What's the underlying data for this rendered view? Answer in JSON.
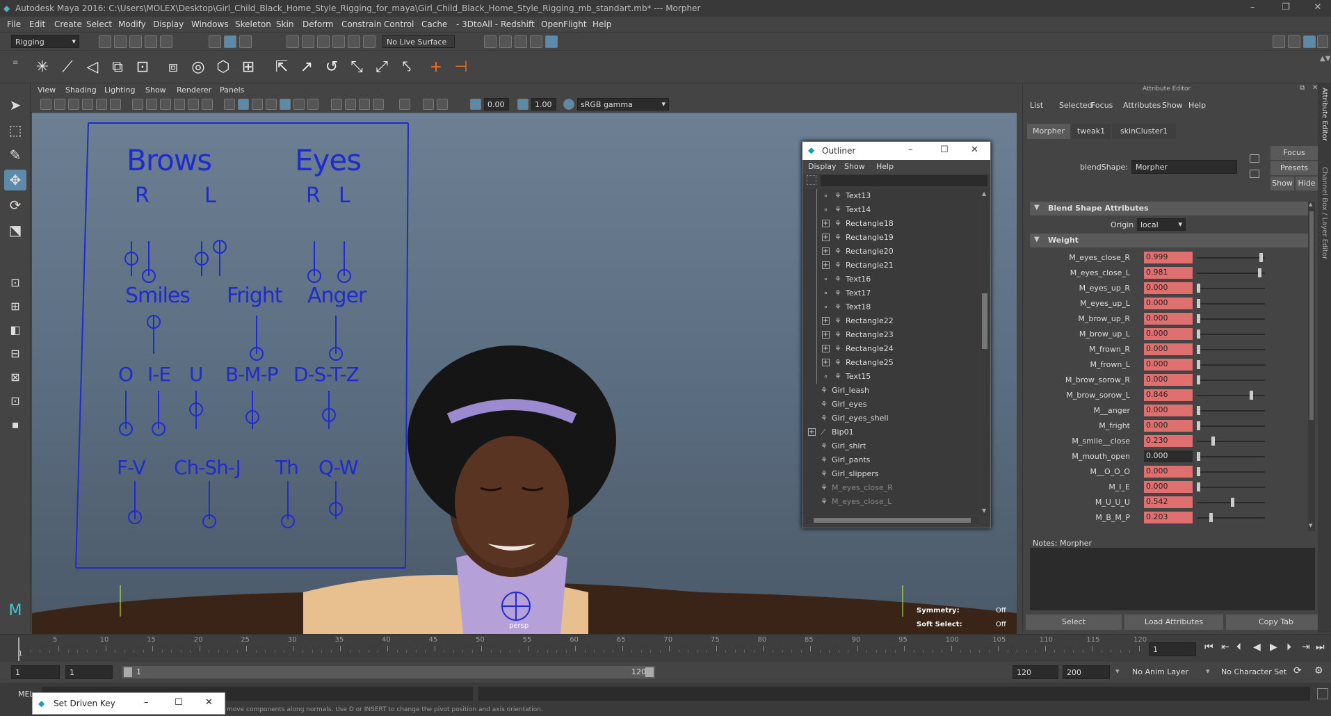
{
  "window": {
    "title": "Autodesk Maya 2016: C:\\Users\\MOLEX\\Desktop\\Girl_Child_Black_Home_Style_Rigging_for_maya\\Girl_Child_Black_Home_Style_Rigging_mb_standart.mb*  ---  Morpher",
    "minimize": "–",
    "restore": "❐",
    "close": "✕"
  },
  "menubar": [
    "File",
    "Edit",
    "Create",
    "Select",
    "Modify",
    "Display",
    "Windows",
    "Skeleton",
    "Skin",
    "Deform",
    "Constrain",
    "Control",
    "Cache",
    "- 3DtoAll -",
    "Redshift",
    "OpenFlight",
    "Help"
  ],
  "statusline": {
    "mode": "Rigging",
    "live_surface": "No Live Surface"
  },
  "viewport_menu": [
    "View",
    "Shading",
    "Lighting",
    "Show",
    "Renderer",
    "Panels"
  ],
  "viewport_toolbar": {
    "val1": "0.00",
    "val2": "1.00",
    "colorspace": "sRGB gamma"
  },
  "rig_panel": {
    "brows": "Brows",
    "eyes": "Eyes",
    "brows_r": "R",
    "brows_l": "L",
    "eyes_r": "R",
    "eyes_l": "L",
    "smiles": "Smiles",
    "fright": "Fright",
    "anger": "Anger",
    "o": "O",
    "ie": "I-E",
    "u": "U",
    "bmp": "B-M-P",
    "dstz": "D-S-T-Z",
    "fv": "F-V",
    "chshj": "Ch-Sh-J",
    "th": "Th",
    "qw": "Q-W"
  },
  "viewport_hud": {
    "symmetry": "Symmetry:",
    "symmetry_val": "Off",
    "soft": "Soft Select:",
    "soft_val": "Off",
    "camera": "persp"
  },
  "outliner": {
    "title": "Outliner",
    "menu": [
      "Display",
      "Show",
      "Help"
    ],
    "items": [
      {
        "label": "Text13",
        "expand": false,
        "indent": 2
      },
      {
        "label": "Text14",
        "expand": false,
        "indent": 2
      },
      {
        "label": "Rectangle18",
        "expand": true,
        "indent": 2
      },
      {
        "label": "Rectangle19",
        "expand": true,
        "indent": 2
      },
      {
        "label": "Rectangle20",
        "expand": true,
        "indent": 2
      },
      {
        "label": "Rectangle21",
        "expand": true,
        "indent": 2
      },
      {
        "label": "Text16",
        "expand": false,
        "indent": 2
      },
      {
        "label": "Text17",
        "expand": false,
        "indent": 2
      },
      {
        "label": "Text18",
        "expand": false,
        "indent": 2
      },
      {
        "label": "Rectangle22",
        "expand": true,
        "indent": 2
      },
      {
        "label": "Rectangle23",
        "expand": true,
        "indent": 2
      },
      {
        "label": "Rectangle24",
        "expand": true,
        "indent": 2
      },
      {
        "label": "Rectangle25",
        "expand": true,
        "indent": 2
      },
      {
        "label": "Text15",
        "expand": false,
        "indent": 2
      },
      {
        "label": "Girl_leash",
        "expand": false,
        "indent": 1
      },
      {
        "label": "Girl_eyes",
        "expand": false,
        "indent": 1
      },
      {
        "label": "Girl_eyes_shell",
        "expand": false,
        "indent": 1
      },
      {
        "label": "Bip01",
        "expand": true,
        "indent": 1
      },
      {
        "label": "Girl_shirt",
        "expand": false,
        "indent": 1
      },
      {
        "label": "Girl_pants",
        "expand": false,
        "indent": 1
      },
      {
        "label": "Girl_slippers",
        "expand": false,
        "indent": 1
      },
      {
        "label": "M_eyes_close_R",
        "expand": false,
        "indent": 1,
        "dim": true
      },
      {
        "label": "M_eyes_close_L",
        "expand": false,
        "indent": 1,
        "dim": true
      }
    ]
  },
  "attribute_editor": {
    "title": "Attribute Editor",
    "menu": [
      "List",
      "Selected",
      "Focus",
      "Attributes",
      "Show",
      "Help"
    ],
    "tabs": [
      "Morpher",
      "tweak1",
      "skinCluster1"
    ],
    "blendshape_label": "blendShape:",
    "blendshape_value": "Morpher",
    "focus": "Focus",
    "presets": "Presets",
    "show": "Show",
    "hide": "Hide",
    "section_blend": "Blend Shape Attributes",
    "origin_label": "Origin",
    "origin_value": "local",
    "section_weight": "Weight",
    "weights": [
      {
        "name": "M_eyes_close_R",
        "value": 0.999,
        "text": "0.999",
        "active": true
      },
      {
        "name": "M_eyes_close_L",
        "value": 0.981,
        "text": "0.981",
        "active": true
      },
      {
        "name": "M_eyes_up_R",
        "value": 0.0,
        "text": "0.000",
        "active": true
      },
      {
        "name": "M_eyes_up_L",
        "value": 0.0,
        "text": "0.000",
        "active": true
      },
      {
        "name": "M_brow_up_R",
        "value": 0.0,
        "text": "0.000",
        "active": true
      },
      {
        "name": "M_brow_up_L",
        "value": 0.0,
        "text": "0.000",
        "active": true
      },
      {
        "name": "M_frown_R",
        "value": 0.0,
        "text": "0.000",
        "active": true
      },
      {
        "name": "M_frown_L",
        "value": 0.0,
        "text": "0.000",
        "active": true
      },
      {
        "name": "M_brow_sorow_R",
        "value": 0.0,
        "text": "0.000",
        "active": true
      },
      {
        "name": "M_brow_sorow_L",
        "value": 0.846,
        "text": "0.846",
        "active": true
      },
      {
        "name": "M__anger",
        "value": 0.0,
        "text": "0.000",
        "active": true
      },
      {
        "name": "M_fright",
        "value": 0.0,
        "text": "0.000",
        "active": true
      },
      {
        "name": "M_smile__close",
        "value": 0.23,
        "text": "0.230",
        "active": true
      },
      {
        "name": "M_mouth_open",
        "value": 0.0,
        "text": "0.000",
        "active": false
      },
      {
        "name": "M__O_O_O",
        "value": 0.0,
        "text": "0.000",
        "active": true
      },
      {
        "name": "M_I_E",
        "value": 0.0,
        "text": "0.000",
        "active": true
      },
      {
        "name": "M_U_U_U",
        "value": 0.542,
        "text": "0.542",
        "active": true
      },
      {
        "name": "M_B_M_P",
        "value": 0.203,
        "text": "0.203",
        "active": true
      }
    ],
    "notes": "Notes:  Morpher",
    "btn_select": "Select",
    "btn_load": "Load Attributes",
    "btn_copy": "Copy Tab",
    "side_tab1": "Attribute Editor",
    "side_tab2": "Channel Box / Layer Editor"
  },
  "timeline": {
    "ticks": [
      "5",
      "10",
      "15",
      "20",
      "25",
      "30",
      "35",
      "40",
      "45",
      "50",
      "55",
      "60",
      "65",
      "70",
      "75",
      "80",
      "85",
      "90",
      "95",
      "100",
      "105",
      "110",
      "115",
      "120"
    ],
    "start_marker": "1",
    "current_frame": "1"
  },
  "range": {
    "start": "1",
    "start2": "1",
    "slider_start": "1",
    "slider_end": "120",
    "end": "120",
    "end2": "200",
    "anim_layer": "No Anim Layer",
    "char_set": "No Character Set"
  },
  "cmd": {
    "mel": "MEL",
    "help_text": "move components along normals. Use D or INSERT to change the pivot position and axis orientation."
  },
  "set_driven_key": {
    "title": "Set Driven Key"
  }
}
